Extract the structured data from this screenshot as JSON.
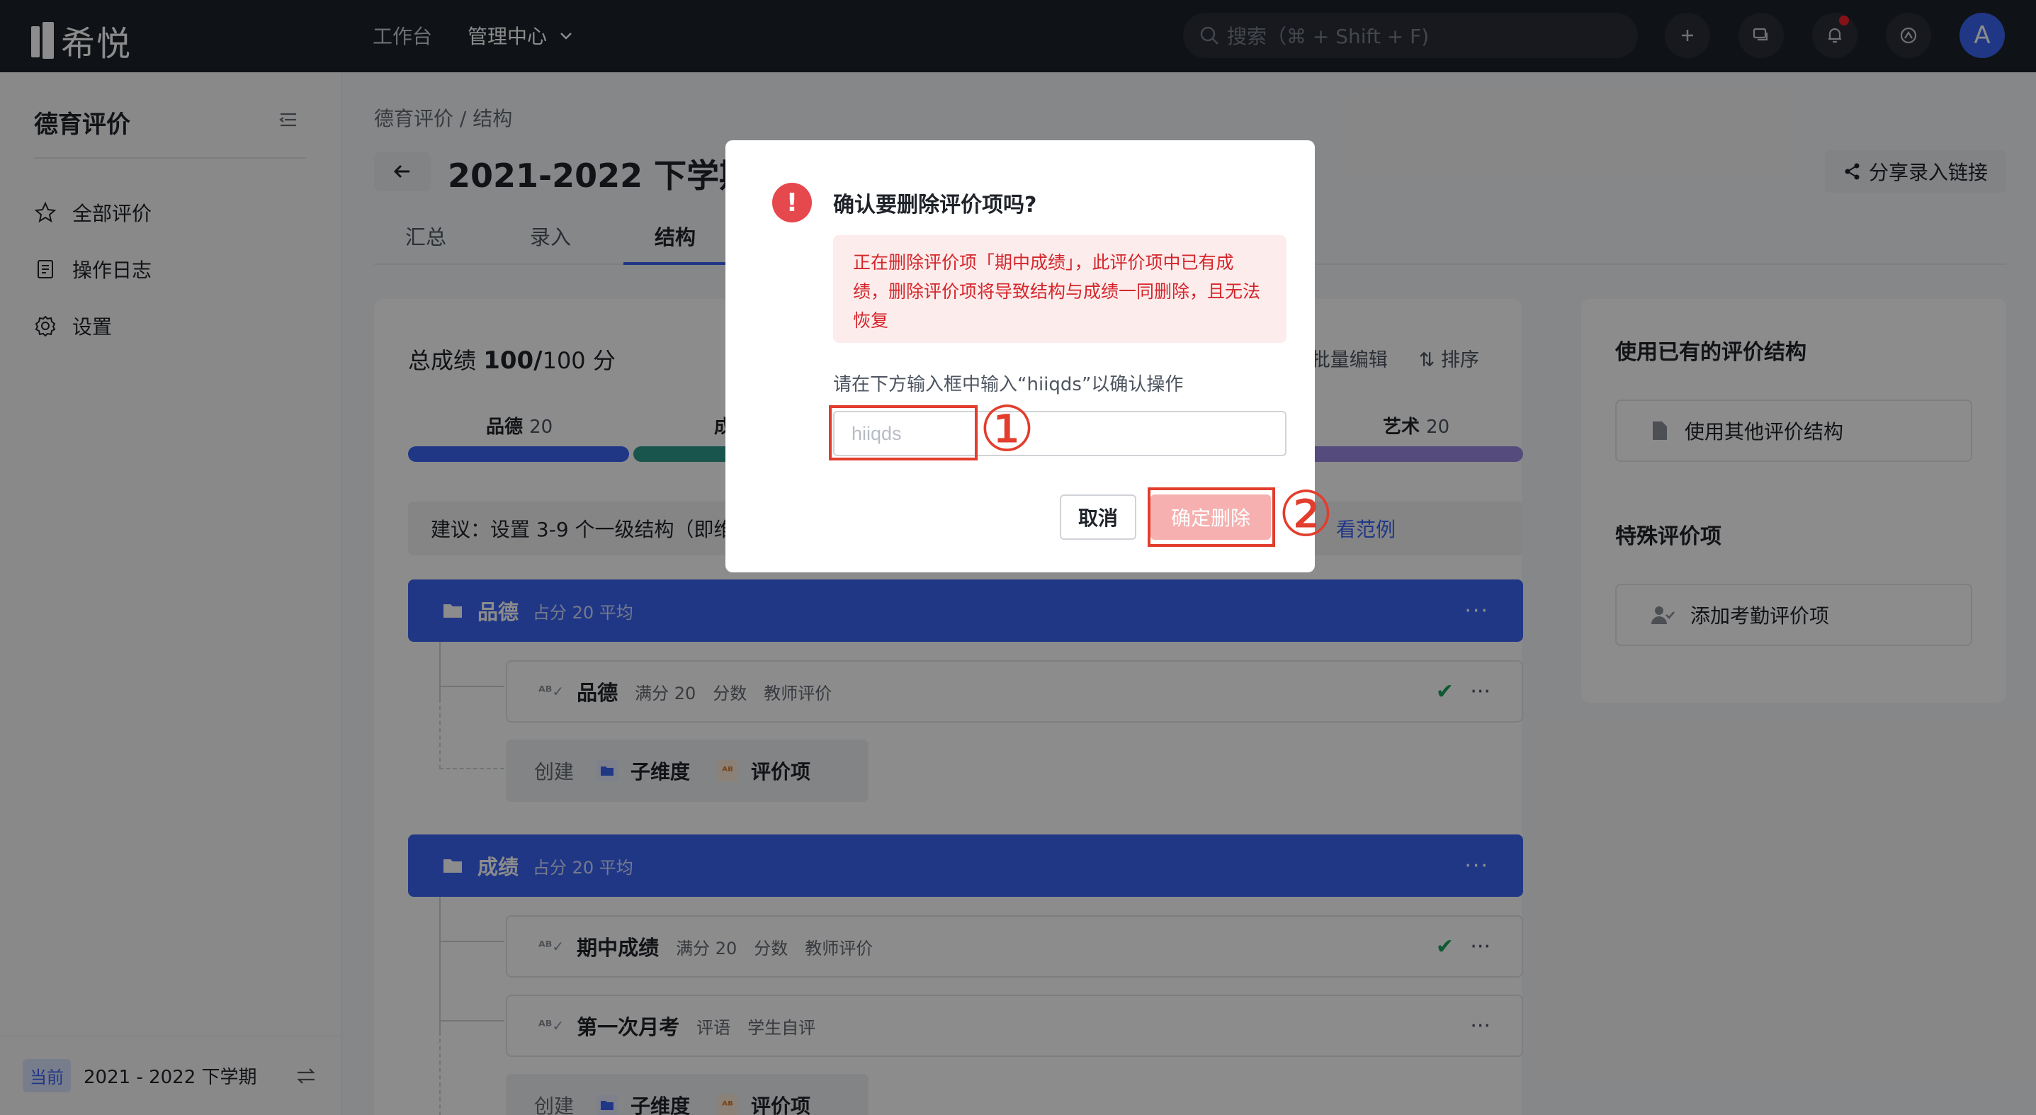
{
  "topbar": {
    "logo_text": "希悦",
    "nav": [
      "工作台",
      "管理中心"
    ],
    "search_placeholder": "搜索（⌘ + Shift + F)",
    "avatar_letter": "A"
  },
  "sidebar": {
    "title": "德育评价",
    "items": [
      "全部评价",
      "操作日志",
      "设置"
    ],
    "footer_badge": "当前",
    "footer_term": "2021 - 2022 下学期"
  },
  "main": {
    "breadcrumb": "德育评价  /  结构",
    "title": "2021-2022 下学期",
    "share_label": "分享录入链接",
    "tabs": [
      "汇总",
      "录入",
      "结构"
    ],
    "total_label": "总成绩",
    "total_value": "100/",
    "total_suffix": "100 分",
    "bulk_edit": "批量编辑",
    "sort": "排序",
    "segments": [
      {
        "name": "品德",
        "value": "20",
        "color": "#3b64f5"
      },
      {
        "name": "成",
        "value": "",
        "color": "#2e9c8c"
      },
      {
        "name": "艺术",
        "value": "20",
        "color": "#9b8be3"
      }
    ],
    "suggest_text": "建议：设置 3-9 个一级结构（即维",
    "suggest_link": "看范例",
    "groups": [
      {
        "name": "品德",
        "meta": "占分 20 平均"
      },
      {
        "name": "成绩",
        "meta": "占分 20 平均"
      }
    ],
    "items": [
      {
        "name": "品德",
        "meta": [
          "满分 20",
          "分数",
          "教师评价"
        ]
      },
      {
        "name": "期中成绩",
        "meta": [
          "满分 20",
          "分数",
          "教师评价"
        ]
      },
      {
        "name": "第一次月考",
        "meta": [
          "评语",
          "学生自评"
        ]
      }
    ],
    "create": {
      "label": "创建",
      "sub_dim": "子维度",
      "eval_item": "评价项"
    },
    "more": "···"
  },
  "right_panel": {
    "title1": "使用已有的评价结构",
    "btn1": "使用其他评价结构",
    "title2": "特殊评价项",
    "btn2": "添加考勤评价项"
  },
  "modal": {
    "title": "确认要删除评价项吗?",
    "alert": "正在删除评价项「期中成绩」，此评价项中已有成绩，删除评价项将导致结构与成绩一同删除，且无法恢复",
    "hint": "请在下方输入框中输入“hiiqds”以确认操作",
    "input_placeholder": "hiiqds",
    "cancel": "取消",
    "confirm": "确定删除",
    "anno1": "①",
    "anno2": "②"
  }
}
